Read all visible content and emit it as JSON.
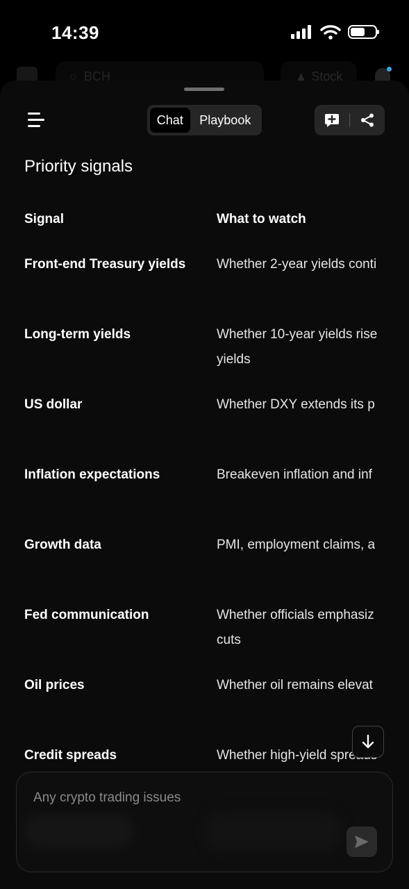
{
  "status_bar": {
    "time": "14:39"
  },
  "background_app": {
    "search_placeholder": "BCH",
    "stock_label": "Stock"
  },
  "header": {
    "tabs": [
      {
        "label": "Chat",
        "active": true
      },
      {
        "label": "Playbook",
        "active": false
      }
    ]
  },
  "content": {
    "title": "Priority signals",
    "table": {
      "headers": [
        "Signal",
        "What to watch"
      ],
      "rows": [
        {
          "signal": "Front-end Treasury yields",
          "watch": "Whether 2-year yields conti"
        },
        {
          "signal": "Long-term yields",
          "watch": "Whether 10-year yields rise\nyields"
        },
        {
          "signal": "US dollar",
          "watch": "Whether DXY extends its p"
        },
        {
          "signal": "Inflation expectations",
          "watch": "Breakeven inflation and inf"
        },
        {
          "signal": "Growth data",
          "watch": "PMI, employment claims, a"
        },
        {
          "signal": "Fed communication",
          "watch": "Whether officials emphasiz\ncuts"
        },
        {
          "signal": "Oil prices",
          "watch": "Whether oil remains elevat"
        },
        {
          "signal": "Credit spreads",
          "watch": "Whether high-yield spreads"
        }
      ]
    }
  },
  "composer": {
    "placeholder": "Any crypto trading issues"
  },
  "colors": {
    "background": "#000000",
    "sheet": "#0b0b0b",
    "control": "#262626",
    "accent_dot": "#3aa3e0"
  }
}
